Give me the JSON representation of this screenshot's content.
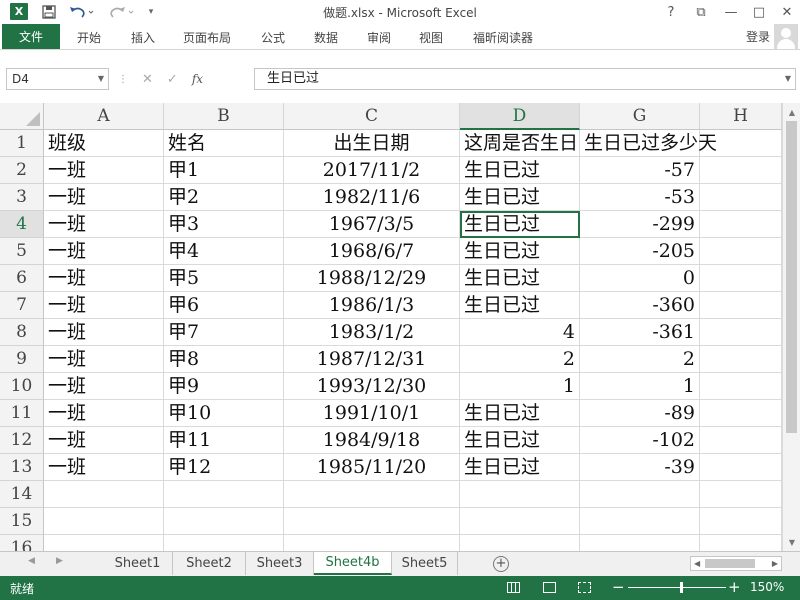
{
  "window": {
    "title": "做题.xlsx - Microsoft Excel",
    "app_icon_letter": "X",
    "help": "?",
    "minimize": "—",
    "maximize": "□",
    "close": "✕",
    "ribbon_display": "⧉"
  },
  "ribbon": {
    "file": "文件",
    "tabs": [
      "开始",
      "插入",
      "页面布局",
      "公式",
      "数据",
      "审阅",
      "视图",
      "福昕阅读器"
    ],
    "login": "登录"
  },
  "formula_bar": {
    "name_box": "D4",
    "cancel": "✕",
    "enter": "✓",
    "fx": "fx",
    "content": "生日已过"
  },
  "sheet": {
    "columns": [
      "A",
      "B",
      "C",
      "D",
      "G",
      "H"
    ],
    "selected_column": "D",
    "selected_row": "4",
    "row_numbers": [
      "1",
      "2",
      "3",
      "4",
      "5",
      "6",
      "7",
      "8",
      "9",
      "10",
      "11",
      "12",
      "13",
      "14",
      "15",
      "16"
    ],
    "rows": [
      [
        "班级",
        "姓名",
        "出生日期",
        "这周是否生日",
        "生日已过多少天"
      ],
      [
        "一班",
        "甲1",
        "2017/11/2",
        "生日已过",
        "-57"
      ],
      [
        "一班",
        "甲2",
        "1982/11/6",
        "生日已过",
        "-53"
      ],
      [
        "一班",
        "甲3",
        "1967/3/5",
        "生日已过",
        "-299"
      ],
      [
        "一班",
        "甲4",
        "1968/6/7",
        "生日已过",
        "-205"
      ],
      [
        "一班",
        "甲5",
        "1988/12/29",
        "生日已过",
        "0"
      ],
      [
        "一班",
        "甲6",
        "1986/1/3",
        "生日已过",
        "-360"
      ],
      [
        "一班",
        "甲7",
        "1983/1/2",
        "4",
        "-361"
      ],
      [
        "一班",
        "甲8",
        "1987/12/31",
        "2",
        "2"
      ],
      [
        "一班",
        "甲9",
        "1993/12/30",
        "1",
        "1"
      ],
      [
        "一班",
        "甲10",
        "1991/10/1",
        "生日已过",
        "-89"
      ],
      [
        "一班",
        "甲11",
        "1984/9/18",
        "生日已过",
        "-102"
      ],
      [
        "一班",
        "甲12",
        "1985/11/20",
        "生日已过",
        "-39"
      ]
    ]
  },
  "sheet_tabs": {
    "tabs": [
      "Sheet1",
      "Sheet2",
      "Sheet3",
      "Sheet4b",
      "Sheet5"
    ],
    "active": "Sheet4b",
    "add": "+"
  },
  "status_bar": {
    "status": "就绪",
    "zoom": "150%",
    "zoom_minus": "−",
    "zoom_plus": "+"
  },
  "colors": {
    "excel_green": "#217346"
  }
}
